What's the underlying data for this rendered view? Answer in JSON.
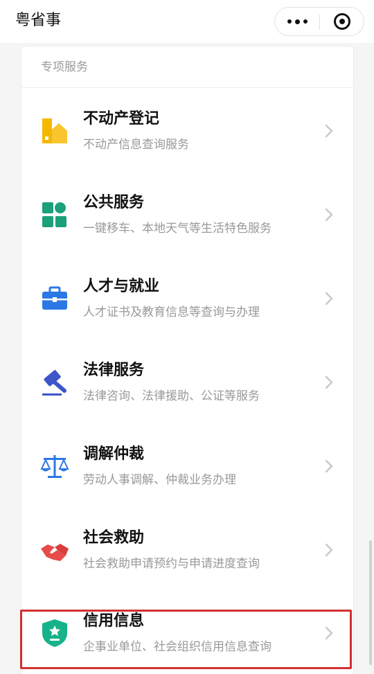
{
  "app": {
    "title": "粤省事",
    "more_icon": "more-dots-icon",
    "close_icon": "target-close-icon"
  },
  "section": {
    "title": "专项服务"
  },
  "items": [
    {
      "title": "不动产登记",
      "desc": "不动产信息查询服务",
      "icon": "house-icon",
      "color": "#f5b800"
    },
    {
      "title": "公共服务",
      "desc": "一键移车、本地天气等生活特色服务",
      "icon": "grid-apps-icon",
      "color": "#1aa07a"
    },
    {
      "title": "人才与就业",
      "desc": "人才证书及教育信息等查询与办理",
      "icon": "briefcase-icon",
      "color": "#2b78e4"
    },
    {
      "title": "法律服务",
      "desc": "法律咨询、法律援助、公证等服务",
      "icon": "gavel-icon",
      "color": "#3d55c8"
    },
    {
      "title": "调解仲裁",
      "desc": "劳动人事调解、仲裁业务办理",
      "icon": "scales-icon",
      "color": "#2b78e4"
    },
    {
      "title": "社会救助",
      "desc": "社会救助申请预约与申请进度查询",
      "icon": "handshake-icon",
      "color": "#e84b4b"
    },
    {
      "title": "信用信息",
      "desc": "企事业单位、社会组织信用信息查询",
      "icon": "shield-star-icon",
      "color": "#16b38a"
    }
  ],
  "colors": {
    "highlight": "#d32f2f",
    "chevron": "#c8c8c8"
  }
}
